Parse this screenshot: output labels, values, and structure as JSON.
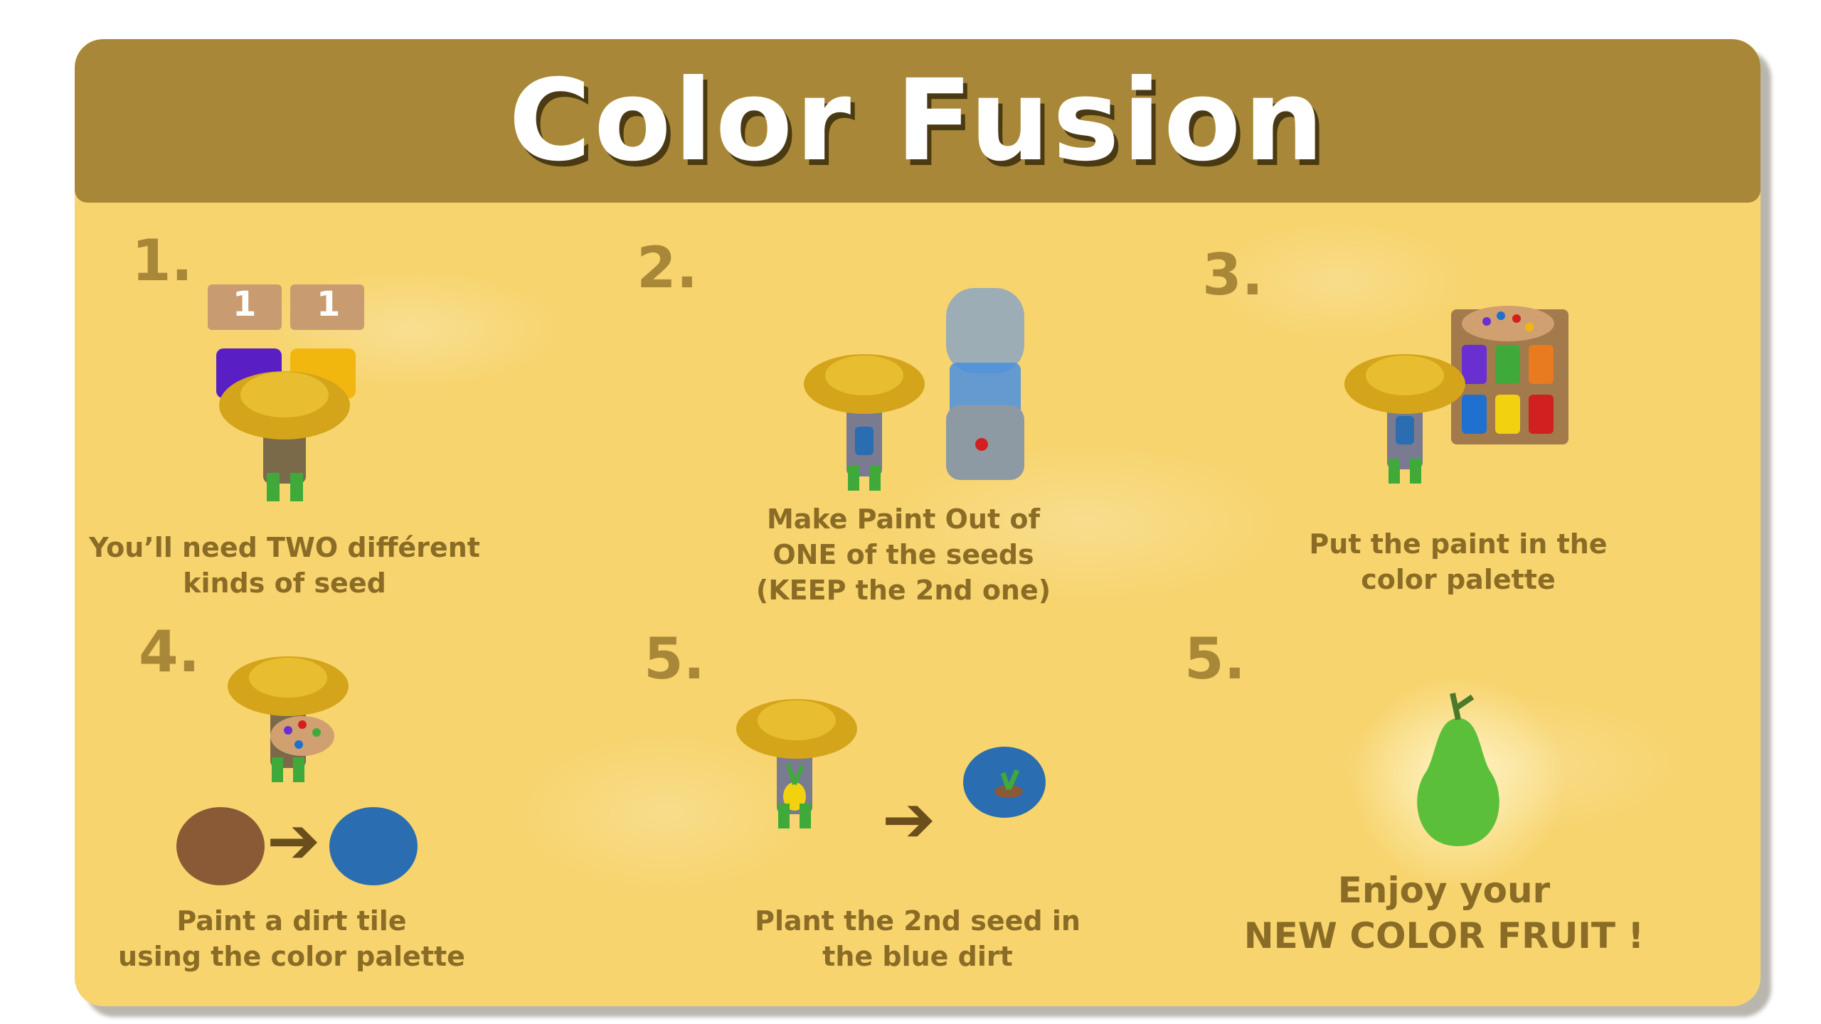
{
  "title": "Color Fusion",
  "steps": [
    {
      "number": "1.",
      "lines": [
        "You’ll need TWO différent",
        "kinds of seed"
      ],
      "signs": [
        "1",
        "1"
      ]
    },
    {
      "number": "2.",
      "lines": [
        "Make Paint Out of",
        "ONE of the seeds",
        "(KEEP the 2nd one)"
      ]
    },
    {
      "number": "3.",
      "lines": [
        "Put the paint in the",
        "color palette"
      ]
    },
    {
      "number": "4.",
      "lines": [
        "Paint a dirt tile",
        "using the color palette"
      ]
    },
    {
      "number": "5.",
      "lines": [
        "Plant the 2nd seed in",
        "the blue dirt"
      ]
    },
    {
      "number": "5.",
      "lines": [
        "Enjoy your",
        "NEW COLOR FRUIT !"
      ]
    }
  ],
  "colors": {
    "header": "#a88838",
    "background": "#f7d46e",
    "text": "#8a6c26",
    "hat": "#d4a51a",
    "blue_dirt": "#2a6db0",
    "dirt": "#8a5a36",
    "fruit": "#5cbf3a"
  }
}
